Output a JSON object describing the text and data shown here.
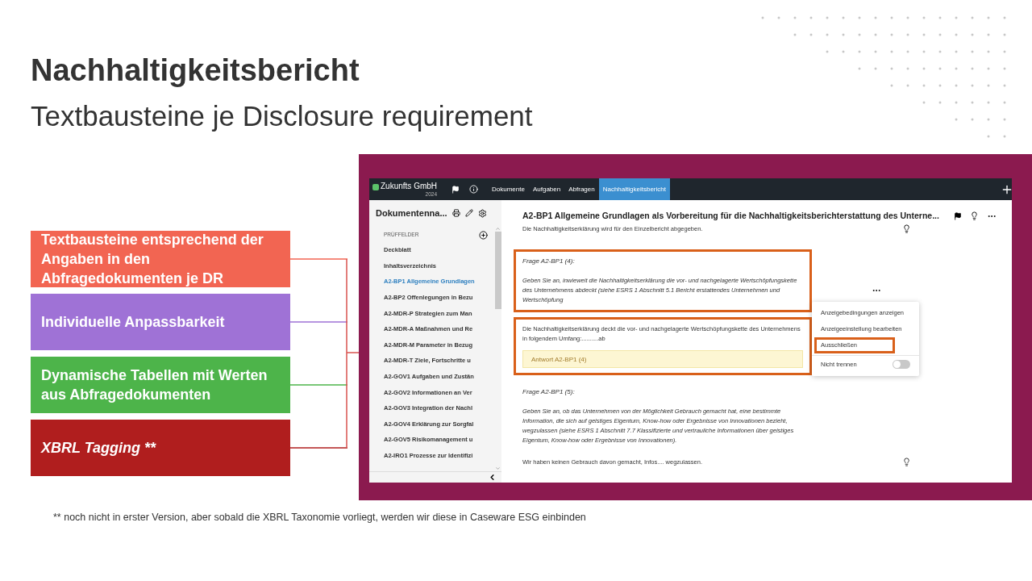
{
  "slide": {
    "title": "Nachhaltigkeitsbericht",
    "subtitle": "Textbausteine je Disclosure requirement",
    "footnote": "** noch nicht in erster Version, aber sobald die XBRL Taxonomie vorliegt, werden wir diese in Caseware ESG einbinden"
  },
  "features": [
    {
      "text": "Textbausteine entsprechend der Angaben in den Abfragedokumenten je DR",
      "color": "#f26552",
      "italic": false
    },
    {
      "text": "Individuelle Anpassbarkeit",
      "color": "#9f72d6",
      "italic": false
    },
    {
      "text": "Dynamische Tabellen mit Werten aus Abfragedokumenten",
      "color": "#4db44a",
      "italic": false
    },
    {
      "text": "XBRL Tagging **",
      "color": "#b01e1e",
      "italic": true
    }
  ],
  "app": {
    "company": "Zukunfts GmbH",
    "year": "2024",
    "nav": [
      {
        "label": "Dokumente",
        "selected": false
      },
      {
        "label": "Aufgaben",
        "selected": false
      },
      {
        "label": "Abfragen",
        "selected": false
      },
      {
        "label": "Nachhaltigkeitsbericht",
        "selected": true
      }
    ],
    "sidebar": {
      "title": "Dokumentenna...",
      "section": "PRÜFFELDER",
      "items": [
        {
          "label": "Deckblatt",
          "selected": false
        },
        {
          "label": "Inhaltsverzeichnis",
          "selected": false
        },
        {
          "label": "A2-BP1 Allgemeine Grundlagen",
          "selected": true
        },
        {
          "label": "A2-BP2 Offenlegungen in Bezu",
          "selected": false
        },
        {
          "label": "A2-MDR-P Strategien zum Man",
          "selected": false
        },
        {
          "label": "A2-MDR-A Maßnahmen und Re",
          "selected": false
        },
        {
          "label": "A2-MDR-M Parameter in Bezug",
          "selected": false
        },
        {
          "label": "A2-MDR-T Ziele, Fortschritte u",
          "selected": false
        },
        {
          "label": "A2-GOV1 Aufgaben und Zustän",
          "selected": false
        },
        {
          "label": "A2-GOV2 Informationen an Ver",
          "selected": false
        },
        {
          "label": "A2-GOV3 Integration der Nachl",
          "selected": false
        },
        {
          "label": "A2-GOV4 Erklärung zur Sorgfal",
          "selected": false
        },
        {
          "label": "A2-GOV5 Risikomanagement u",
          "selected": false
        },
        {
          "label": "A2-IRO1 Prozesse zur Identifizi",
          "selected": false
        }
      ]
    },
    "content": {
      "title": "A2-BP1 Allgemeine Grundlagen als Vorbereitung für die Nachhaltigkeitsberichterstattung des Unterne...",
      "intro": "Die Nachhaltigkeitserklärung wird für den Einzelbericht abgegeben.",
      "blocks": [
        {
          "kind": "question",
          "label": "Frage A2-BP1 (4):",
          "text": "Geben Sie an, inwieweit die Nachhaltigkeitserklärung die vor- und nachgelagerte Wertschöpfungskette des Unternehmens abdeckt (siehe ESRS 1 Abschnitt 5.1 Bericht erstattendes Unternehmen und Wertschöpfung",
          "highlighted": true
        },
        {
          "kind": "answer",
          "text": "Die Nachhaltigkeitserklärung deckt die vor- und nachgelagerte Wertschöpfungskette des Unternehmens in folgendem Umfang:..........ab",
          "placeholder": "Antwort A2-BP1 (4)",
          "highlighted": true
        },
        {
          "kind": "question",
          "label": "Frage A2-BP1 (5):",
          "text": "Geben Sie an, ob das Unternehmen von der Möglichkeit Gebrauch gemacht hat, eine bestimmte Information, die sich auf geistiges Eigentum, Know-how oder Ergebnisse von Innovationen bezieht, wegzulassen (siehe ESRS 1 Abschnitt 7.7 Klassifizierte und vertrauliche Informationen über geistiges Eigentum, Know-how oder Ergebnisse von Innovationen).",
          "highlighted": false
        },
        {
          "kind": "text",
          "text": "Wir haben keinen Gebrauch davon gemacht, Infos.... wegzulassen.",
          "highlighted": false
        }
      ],
      "menu": {
        "items": [
          {
            "label": "Anzeigebedingungen anzeigen",
            "highlighted": false
          },
          {
            "label": "Anzeigeeinstellung bearbeiten",
            "highlighted": false
          },
          {
            "label": "Ausschließen",
            "highlighted": true
          }
        ],
        "toggle": {
          "label": "Nicht trennen",
          "on": false
        }
      }
    }
  }
}
